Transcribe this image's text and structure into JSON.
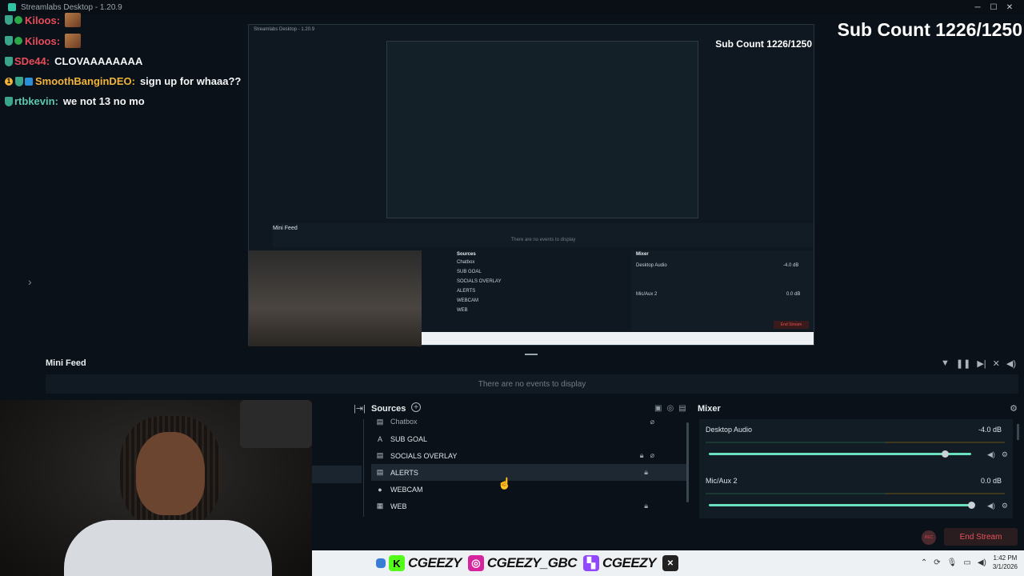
{
  "window": {
    "title": "Streamlabs Desktop - 1.20.9",
    "minimize": "─",
    "maximize": "☐",
    "close": "✕"
  },
  "chat": [
    {
      "user": "Kiloos:",
      "message": "",
      "user_color": "#e84b5a"
    },
    {
      "user": "Kiloos:",
      "message": "",
      "user_color": "#e84b5a"
    },
    {
      "user": "SDe44:",
      "message": "CLOVAAAAAAAA",
      "user_color": "#e84b5a"
    },
    {
      "user": "SmoothBanginDEO:",
      "message": "sign up for whaaa??",
      "user_color": "#f3b43a",
      "badge_text": "1"
    },
    {
      "user": "rtbkevin:",
      "message": "we not 13 no mo",
      "user_color": "#5fc7b0"
    }
  ],
  "sub_count": "Sub Count 1226/1250",
  "nested": {
    "title": "Streamlabs Desktop - 1.20.9",
    "sub_count": "Sub Count 1226/1250",
    "minifeed_label": "Mini Feed",
    "empty": "There are no events to display",
    "sources_title": "Sources",
    "mixer_title": "Mixer",
    "desktop_audio": "Desktop Audio",
    "desktop_db": "-4.0 dB",
    "mic_aux": "Mic/Aux 2",
    "mic_db": "0.0 dB",
    "end_stream": "End Stream",
    "sources": [
      "Chatbox",
      "SUB GOAL",
      "SOCIALS OVERLAY",
      "ALERTS",
      "WEBCAM",
      "WEB"
    ]
  },
  "minifeed": {
    "label": "Mini Feed",
    "empty": "There are no events to display"
  },
  "sources": {
    "title": "Sources",
    "items": [
      {
        "name": "Chatbox",
        "icon": "▤"
      },
      {
        "name": "SUB GOAL",
        "icon": "A"
      },
      {
        "name": "SOCIALS OVERLAY",
        "icon": "▤"
      },
      {
        "name": "ALERTS",
        "icon": "▤"
      },
      {
        "name": "WEBCAM",
        "icon": "●"
      },
      {
        "name": "WEB",
        "icon": "▦"
      }
    ]
  },
  "mixer": {
    "title": "Mixer",
    "channels": [
      {
        "name": "Desktop Audio",
        "db": "-4.0 dB",
        "level": 0.9
      },
      {
        "name": "Mic/Aux 2",
        "db": "0.0 dB",
        "level": 1.0
      }
    ]
  },
  "footer": {
    "rec": "REC",
    "end_stream": "End Stream"
  },
  "socials": {
    "kick_handle": "CGEEZY",
    "instagram_handle": "CGEEZY_GBC",
    "twitch_handle": "CGEEZY"
  },
  "taskbar": {
    "time": "1:42 PM",
    "date": "3/1/2026"
  },
  "colors": {
    "accent": "#6be0bf",
    "end_stream_text": "#e8515c",
    "background": "#0b1118"
  }
}
